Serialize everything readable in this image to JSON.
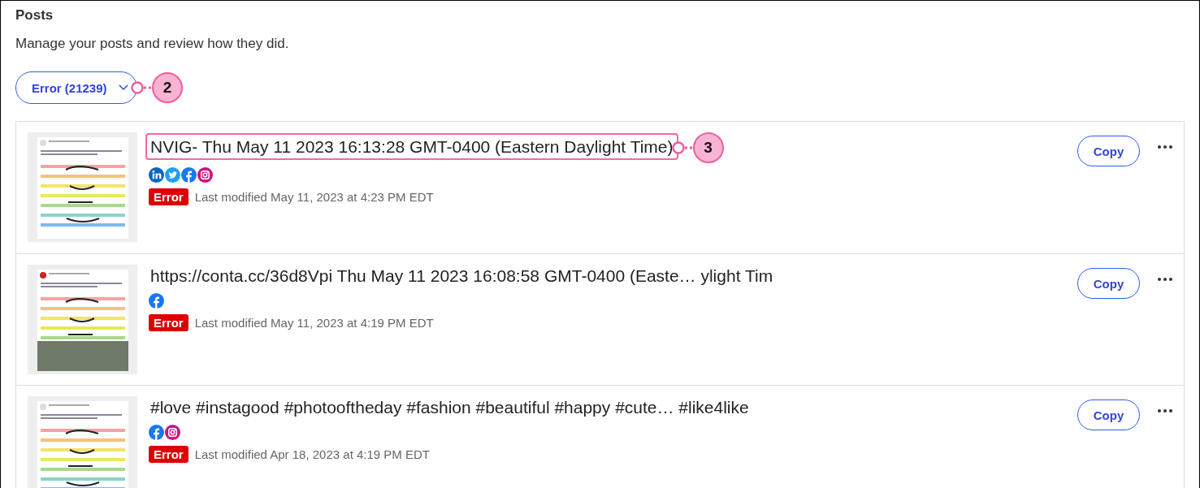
{
  "header": {
    "title": "Posts",
    "subtitle": "Manage your posts and review how they did."
  },
  "filter": {
    "label": "Error (21239)",
    "callout": "2"
  },
  "posts": [
    {
      "title": "NVIG- Thu May 11 2023 16:13:28 GMT-0400 (Eastern Daylight Time)",
      "highlighted": true,
      "callout": "3",
      "networks": [
        {
          "kind": "linkedin"
        },
        {
          "kind": "twitter"
        },
        {
          "kind": "facebook"
        },
        {
          "kind": "instagram"
        }
      ],
      "status": "Error",
      "modified": "Last modified May 11, 2023 at 4:23 PM EDT",
      "preview": {
        "kind": "quote"
      },
      "action": "Copy"
    },
    {
      "title": "https://conta.cc/36d8Vpi Thu May 11 2023 16:08:58 GMT-0400 (Easte… ylight Tim",
      "highlighted": false,
      "networks": [
        {
          "kind": "facebook"
        }
      ],
      "status": "Error",
      "modified": "Last modified May 11, 2023 at 4:19 PM EDT",
      "preview": {
        "kind": "photo"
      },
      "action": "Copy"
    },
    {
      "title": "#love #instagood #photooftheday #fashion #beautiful #happy #cute… #like4like",
      "highlighted": false,
      "networks": [
        {
          "kind": "facebook"
        },
        {
          "kind": "instagram"
        }
      ],
      "status": "Error",
      "modified": "Last modified Apr 18, 2023 at 4:19 PM EDT",
      "preview": {
        "kind": "quote"
      },
      "action": "Copy"
    }
  ]
}
